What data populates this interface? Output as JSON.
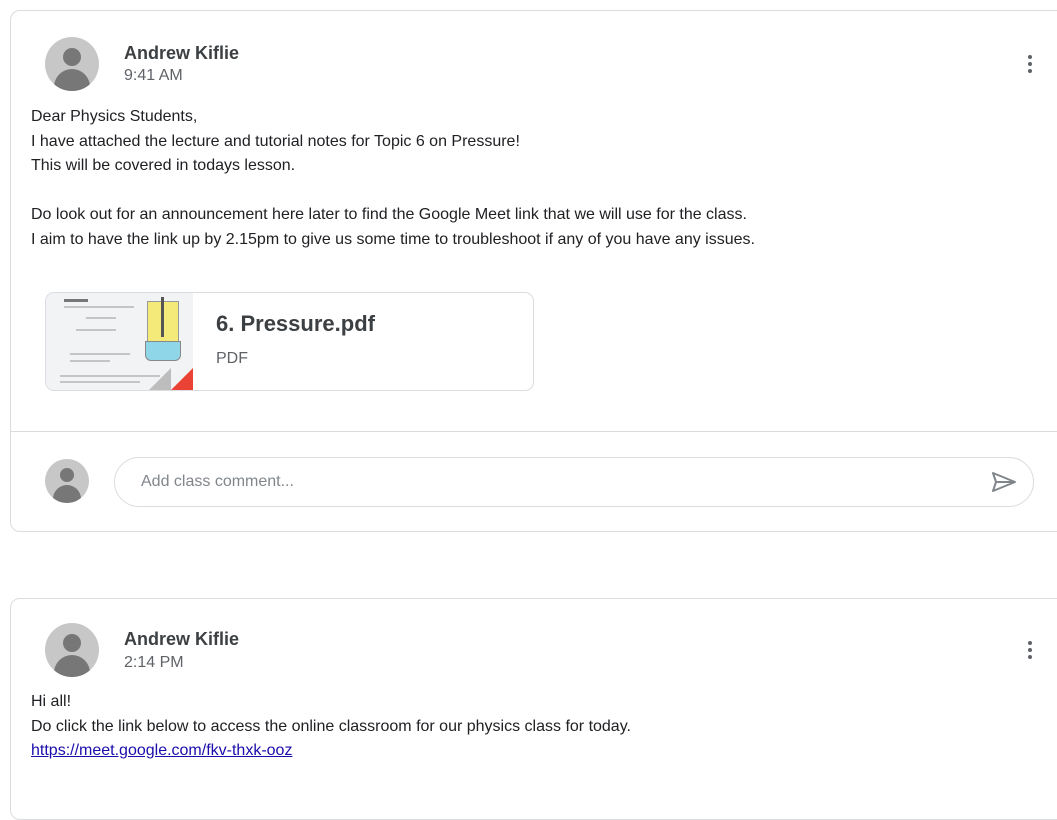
{
  "posts": [
    {
      "author": "Andrew Kiflie",
      "time": "9:41 AM",
      "body_lines": [
        "Dear Physics Students,",
        "I have attached the lecture and tutorial notes for Topic 6 on Pressure!",
        "This will be covered in todays lesson.",
        "",
        "Do look out for an announcement here later to find the Google Meet link that we will use for the class.",
        "I aim to have the link up by 2.15pm to give us some time to troubleshoot if any of you have any issues."
      ],
      "attachment": {
        "name": "6. Pressure.pdf",
        "type": "PDF"
      },
      "comment": {
        "placeholder": "Add class comment...",
        "send_icon": "send-icon"
      }
    },
    {
      "author": "Andrew Kiflie",
      "time": "2:14 PM",
      "body_lines": [
        "Hi all!",
        "Do click the link below to access the online classroom for our physics class for today."
      ],
      "link": "https://meet.google.com/fkv-thxk-ooz"
    }
  ],
  "colors": {
    "border": "#dadce0",
    "link": "#1a0dab",
    "pdf_corner": "#ea4335",
    "avatar_bg": "#c7c7c7"
  },
  "icons": [
    "avatar-icon",
    "more-vert-icon",
    "pdf-icon",
    "send-icon"
  ]
}
